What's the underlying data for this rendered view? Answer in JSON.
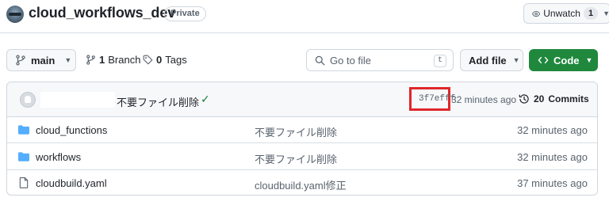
{
  "repo": {
    "name": "cloud_workflows_dev",
    "visibility": "Private"
  },
  "watch": {
    "label": "Unwatch",
    "count": "1"
  },
  "toolbar": {
    "branch": "main",
    "branches_count": "1",
    "branches_label": "Branch",
    "tags_count": "0",
    "tags_label": "Tags",
    "goto_placeholder": "Go to file",
    "goto_shortcut": "t",
    "add_file_label": "Add file",
    "code_label": "Code"
  },
  "latest_commit": {
    "message": "不要ファイル削除",
    "hash": "3f7efff",
    "time": "32 minutes ago",
    "commits_count": "20",
    "commits_label": "Commits",
    "status_color": "#1a7f37",
    "highlight_color": "#e0262a"
  },
  "files": [
    {
      "name": "cloud_functions",
      "type": "folder",
      "message": "不要ファイル削除",
      "date": "32 minutes ago"
    },
    {
      "name": "workflows",
      "type": "folder",
      "message": "不要ファイル削除",
      "date": "32 minutes ago"
    },
    {
      "name": "cloudbuild.yaml",
      "type": "file",
      "message": "cloudbuild.yaml修正",
      "date": "37 minutes ago"
    }
  ],
  "colors": {
    "primary_green": "#1f883d",
    "folder_blue": "#54aeff"
  }
}
